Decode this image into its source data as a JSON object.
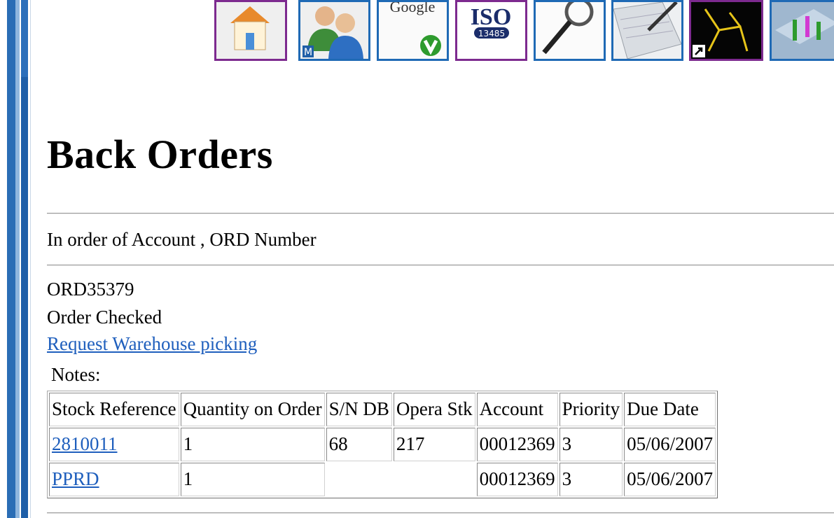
{
  "toolbar": {
    "icons": [
      {
        "name": "home-icon",
        "border": "#7d2a8f"
      },
      {
        "name": "users-icon",
        "border": "#1f6ab5"
      },
      {
        "name": "google-icon",
        "border": "#1f6ab5",
        "text": "Google"
      },
      {
        "name": "iso-icon",
        "border": "#7d2a8f",
        "text": "ISO",
        "subtext": "13485"
      },
      {
        "name": "magnifier-icon",
        "border": "#1f6ab5"
      },
      {
        "name": "notepad-icon",
        "border": "#1f6ab5"
      },
      {
        "name": "shortcut-icon",
        "border": "#7d2a8f"
      },
      {
        "name": "chart-icon",
        "border": "#1f6ab5"
      }
    ]
  },
  "page": {
    "title": "Back Orders",
    "sort_caption": "In order of Account , ORD Number"
  },
  "order": {
    "number": "ORD35379",
    "status": "Order Checked",
    "request_link": "Request Warehouse picking",
    "notes_label": "Notes:"
  },
  "table": {
    "headers": [
      "Stock Reference",
      "Quantity on Order",
      "S/N DB",
      "Opera Stk",
      "Account",
      "Priority",
      "Due Date"
    ],
    "rows": [
      [
        "2810011",
        "1",
        "68",
        "217",
        "00012369",
        "3",
        "05/06/2007"
      ],
      [
        "PPRD",
        "1",
        "",
        "",
        "00012369",
        "3",
        "05/06/2007"
      ]
    ]
  },
  "colors": {
    "link": "#1f5fbd",
    "frame_blue": "#2a6db5",
    "icon_border_blue": "#1f6ab5",
    "icon_border_purple": "#7d2a8f"
  }
}
